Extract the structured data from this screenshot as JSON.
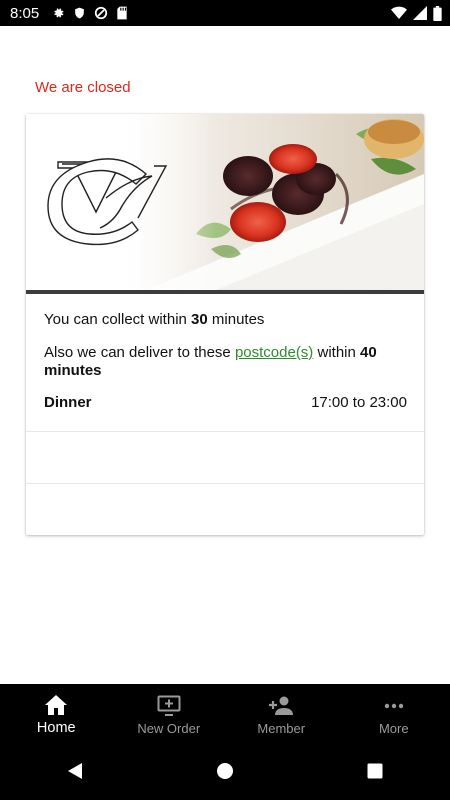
{
  "status_bar": {
    "time": "8:05"
  },
  "notice": {
    "closed_text": "We are closed"
  },
  "restaurant": {
    "collect": {
      "prefix": "You can collect within ",
      "value": "30",
      "suffix": " minutes"
    },
    "deliver": {
      "prefix": "Also we can deliver to these ",
      "link_text": "postcode(s)",
      "middle": " within ",
      "value": "40 minutes"
    },
    "schedule": [
      {
        "label": "Dinner",
        "hours": "17:00 to 23:00"
      }
    ]
  },
  "bottom_nav": {
    "items": [
      {
        "label": "Home",
        "icon": "home-icon",
        "active": true
      },
      {
        "label": "New Order",
        "icon": "monitor-add-icon",
        "active": false
      },
      {
        "label": "Member",
        "icon": "person-add-icon",
        "active": false
      },
      {
        "label": "More",
        "icon": "more-dots-icon",
        "active": false
      }
    ]
  },
  "colors": {
    "closed": "#e4261b",
    "link": "#2e8b2e",
    "nav_bg": "#000000",
    "nav_active": "#ffffff",
    "nav_inactive": "#9a9a9a"
  }
}
